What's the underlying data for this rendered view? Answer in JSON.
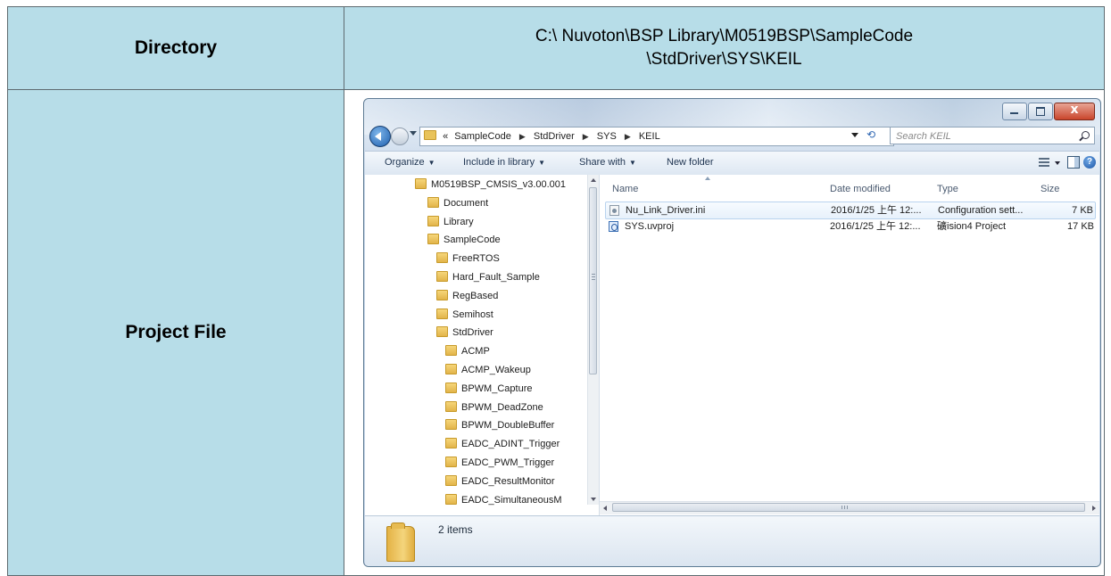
{
  "table": {
    "directory_label": "Directory",
    "directory_line1": "C:\\ Nuvoton\\BSP Library\\M0519BSP\\SampleCode",
    "directory_line2": "\\StdDriver\\SYS\\KEIL",
    "project_file_label": "Project File"
  },
  "explorer": {
    "address": {
      "prefix": "«",
      "crumbs": [
        "SampleCode",
        "StdDriver",
        "SYS",
        "KEIL"
      ]
    },
    "search_placeholder": "Search KEIL",
    "toolbar": {
      "organize": "Organize",
      "include_in_library": "Include in library",
      "share_with": "Share with",
      "new_folder": "New folder"
    },
    "tree": [
      {
        "label": "M0519BSP_CMSIS_v3.00.001",
        "level": 0
      },
      {
        "label": "Document",
        "level": 1
      },
      {
        "label": "Library",
        "level": 1
      },
      {
        "label": "SampleCode",
        "level": 1
      },
      {
        "label": "FreeRTOS",
        "level": 2
      },
      {
        "label": "Hard_Fault_Sample",
        "level": 2
      },
      {
        "label": "RegBased",
        "level": 2
      },
      {
        "label": "Semihost",
        "level": 2
      },
      {
        "label": "StdDriver",
        "level": 2
      },
      {
        "label": "ACMP",
        "level": 3
      },
      {
        "label": "ACMP_Wakeup",
        "level": 3
      },
      {
        "label": "BPWM_Capture",
        "level": 3
      },
      {
        "label": "BPWM_DeadZone",
        "level": 3
      },
      {
        "label": "BPWM_DoubleBuffer",
        "level": 3
      },
      {
        "label": "EADC_ADINT_Trigger",
        "level": 3
      },
      {
        "label": "EADC_PWM_Trigger",
        "level": 3
      },
      {
        "label": "EADC_ResultMonitor",
        "level": 3
      },
      {
        "label": "EADC_SimultaneousM",
        "level": 3
      }
    ],
    "columns": {
      "name": "Name",
      "date": "Date modified",
      "type": "Type",
      "size": "Size"
    },
    "files": [
      {
        "name": "Nu_Link_Driver.ini",
        "date": "2016/1/25 上午 12:...",
        "type": "Configuration sett...",
        "size": "7 KB",
        "icon": "ini-file-icon"
      },
      {
        "name": "SYS.uvproj",
        "date": "2016/1/25 上午 12:...",
        "type": "礦ision4 Project",
        "size": "17 KB",
        "icon": "uvproj-file-icon"
      }
    ],
    "status": {
      "item_count": "2 items"
    }
  }
}
